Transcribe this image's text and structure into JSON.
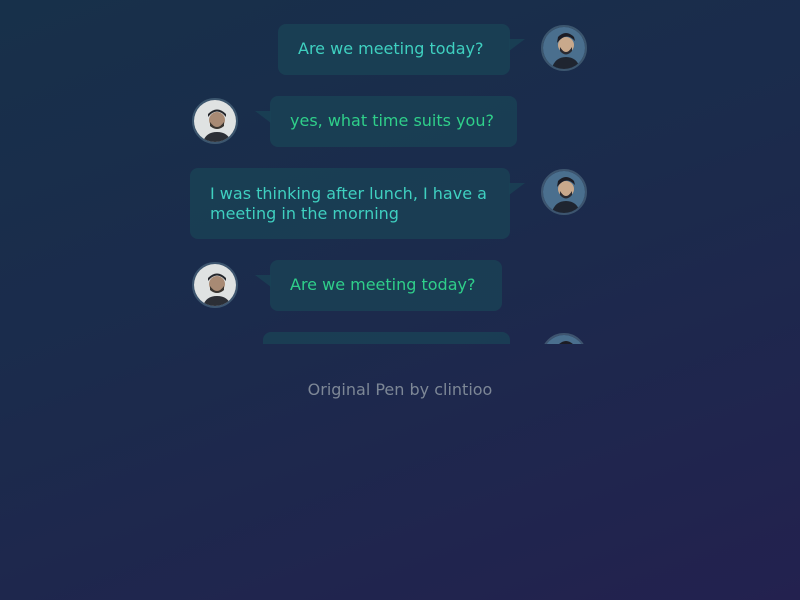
{
  "messages": [
    {
      "text": "Are we meeting today?",
      "side": "right"
    },
    {
      "text": "yes, what time suits you?",
      "side": "left"
    },
    {
      "text": "I was thinking after lunch, I have a meeting in the morning",
      "side": "right"
    },
    {
      "text": "Are we meeting today?",
      "side": "left"
    }
  ],
  "footer": {
    "text": "Original Pen by clintioo"
  },
  "colors": {
    "self_text": "#3fd0c0",
    "other_text": "#2fcf8a",
    "bubble": "#1a4256"
  }
}
